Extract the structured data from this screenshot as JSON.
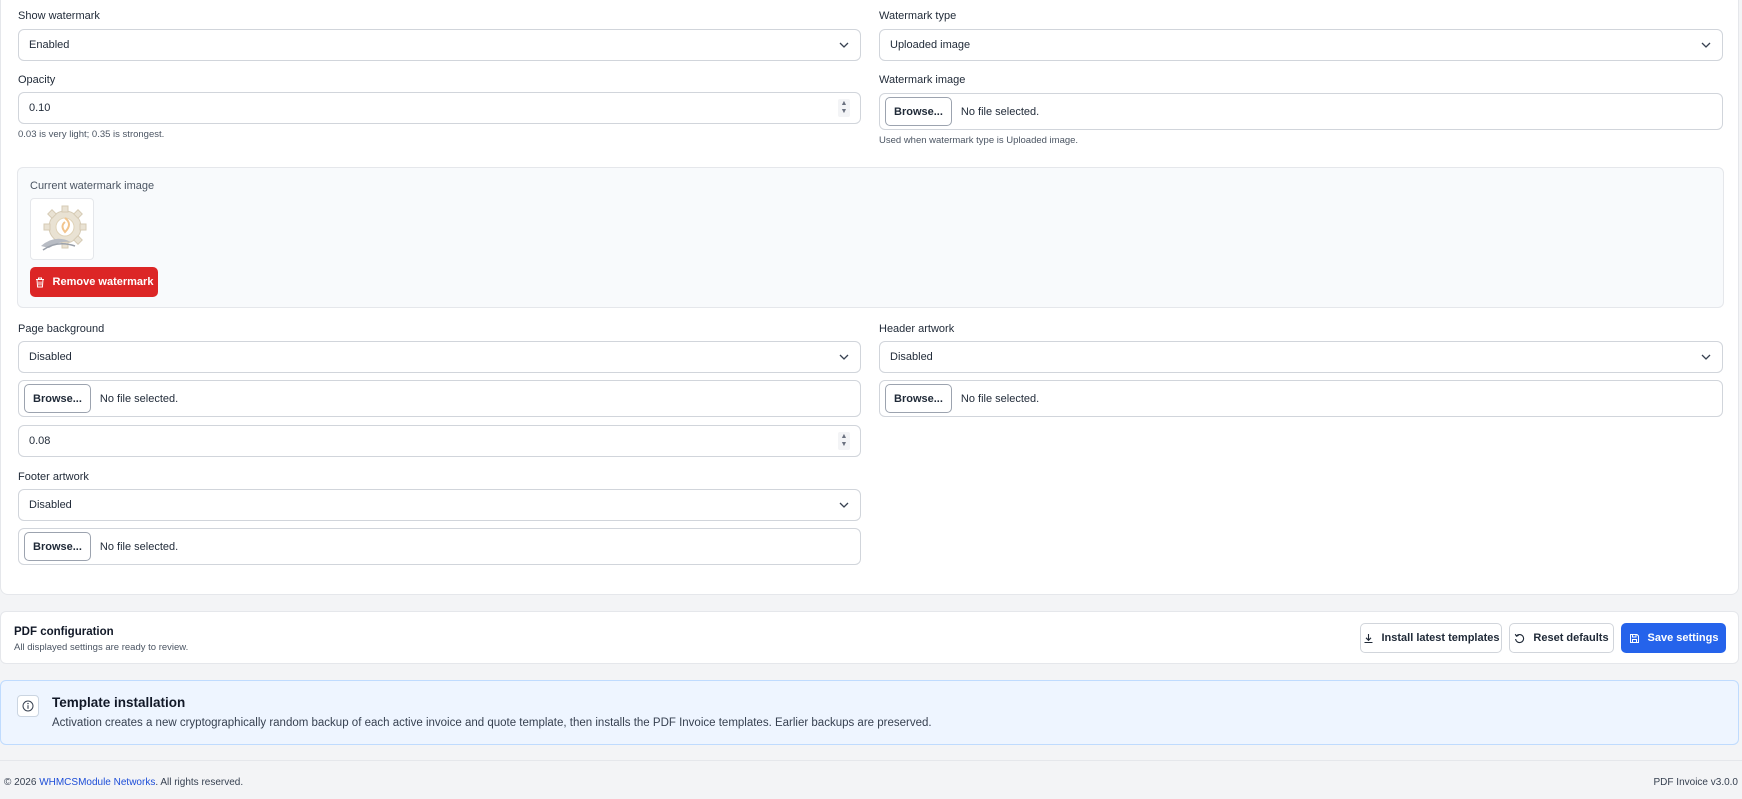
{
  "watermark": {
    "show_label": "Show watermark",
    "show_value": "Enabled",
    "type_label": "Watermark type",
    "type_value": "Uploaded image",
    "opacity_label": "Opacity",
    "opacity_value": "0.10",
    "opacity_help": "0.03 is very light; 0.35 is strongest.",
    "image_label": "Watermark image",
    "image_file_text": "No file selected.",
    "image_help": "Used when watermark type is Uploaded image.",
    "current_label": "Current watermark image",
    "remove_label": "Remove watermark"
  },
  "background": {
    "label": "Page background",
    "value": "Disabled",
    "file_text": "No file selected.",
    "opacity_value": "0.08"
  },
  "header_art": {
    "label": "Header artwork",
    "value": "Disabled",
    "file_text": "No file selected."
  },
  "footer_art": {
    "label": "Footer artwork",
    "value": "Disabled",
    "file_text": "No file selected."
  },
  "browse_label": "Browse...",
  "action_bar": {
    "title": "PDF configuration",
    "subtitle": "All displayed settings are ready to review.",
    "install_label": "Install latest templates",
    "reset_label": "Reset defaults",
    "save_label": "Save settings"
  },
  "info": {
    "title": "Template installation",
    "text": "Activation creates a new cryptographically random backup of each active invoice and quote template, then installs the PDF Invoice templates. Earlier backups are preserved."
  },
  "footer": {
    "copyright_prefix": "© 2026",
    "company": "WHMCSModule Networks",
    "rights": ". All rights reserved.",
    "version": "PDF Invoice v3.0.0"
  },
  "colors": {
    "primary": "#2563eb",
    "danger": "#dc2626",
    "info_bg": "#eef5ff"
  }
}
